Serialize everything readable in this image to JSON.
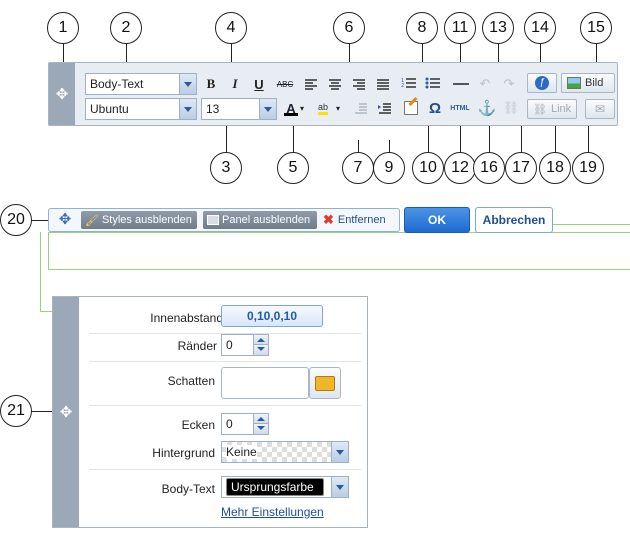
{
  "callouts": [
    "1",
    "2",
    "3",
    "4",
    "5",
    "6",
    "7",
    "8",
    "9",
    "10",
    "11",
    "12",
    "13",
    "14",
    "15",
    "16",
    "17",
    "18",
    "19",
    "20",
    "21"
  ],
  "toolbar": {
    "paragraph_style": "Body-Text",
    "font_family": "Ubuntu",
    "font_size": "13",
    "bold": "B",
    "italic": "I",
    "underline": "U",
    "strike": "ABC",
    "special_char": "Ω",
    "html": "HTML",
    "image_label": "Bild",
    "link_label": "Link",
    "text_color": "#000000"
  },
  "actionbar": {
    "hide_styles": "Styles ausblenden",
    "hide_panel": "Panel ausblenden",
    "remove": "Entfernen",
    "ok": "OK",
    "cancel": "Abbrechen"
  },
  "panel": {
    "padding_label": "Innenabstand",
    "padding_value": "0,10,0,10",
    "borders_label": "Ränder",
    "borders_value": "0",
    "shadow_label": "Schatten",
    "corners_label": "Ecken",
    "corners_value": "0",
    "background_label": "Hintergrund",
    "background_value": "Keine",
    "bodytext_label": "Body-Text",
    "bodytext_value": "Ursprungsfarbe",
    "more_settings": "Mehr Einstellungen"
  }
}
